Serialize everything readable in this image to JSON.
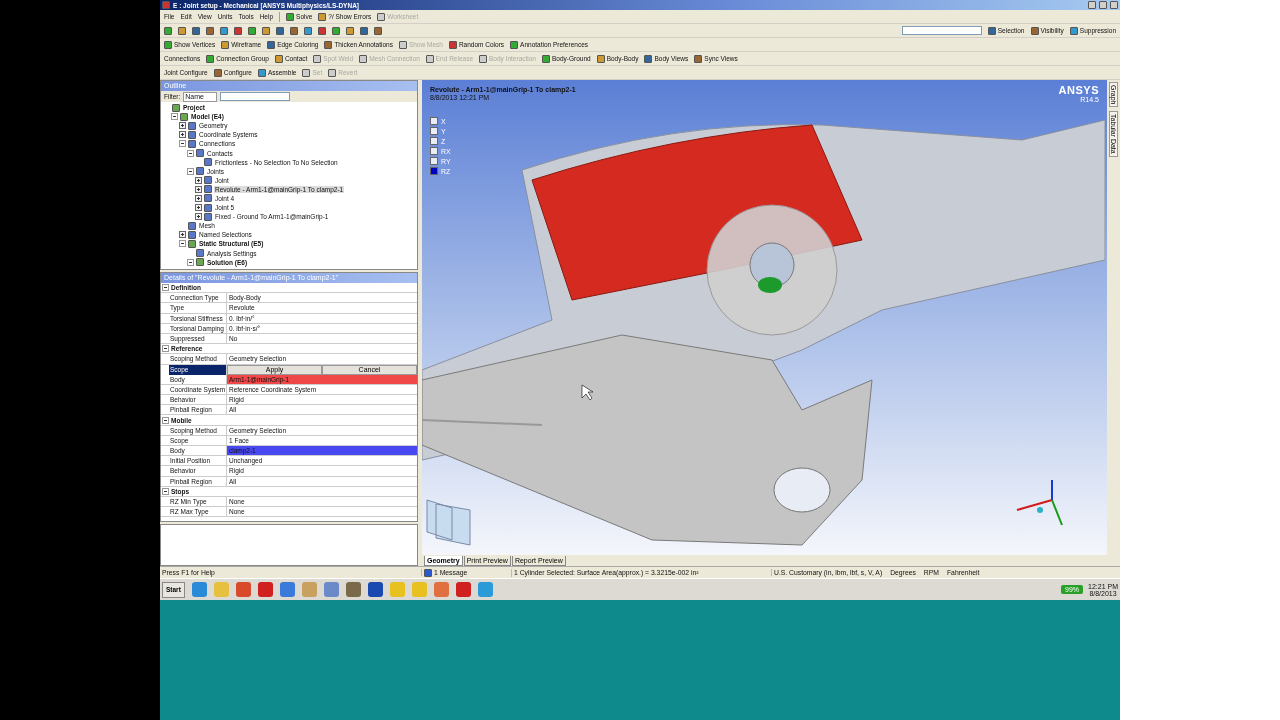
{
  "window": {
    "title": "E : Joint setup - Mechanical [ANSYS Multiphysics/LS-DYNA]"
  },
  "menu": [
    "File",
    "Edit",
    "View",
    "Units",
    "Tools",
    "Help"
  ],
  "toolbar_1": [
    {
      "label": "Solve",
      "disabled": false
    },
    {
      "label": "?/ Show Errors",
      "disabled": false
    },
    {
      "label": "Worksheet",
      "disabled": true
    }
  ],
  "toolbar_2_right": [
    {
      "label": "Selection"
    },
    {
      "label": "Visibility"
    },
    {
      "label": "Suppression"
    }
  ],
  "toolbar_3": [
    {
      "label": "Show Vertices",
      "disabled": false
    },
    {
      "label": "Wireframe",
      "disabled": false
    },
    {
      "label": "Edge Coloring",
      "disabled": false
    },
    {
      "label": "Thicken Annotations",
      "disabled": false
    },
    {
      "label": "Show Mesh",
      "disabled": true
    },
    {
      "label": "Random Colors",
      "disabled": false
    },
    {
      "label": "Annotation Preferences",
      "disabled": false
    }
  ],
  "toolbar_4": {
    "label": "Connections",
    "items": [
      {
        "label": "Connection Group",
        "disabled": false
      },
      {
        "label": "Contact",
        "disabled": false
      },
      {
        "label": "Spot Weld",
        "disabled": true
      },
      {
        "label": "Mesh Connection",
        "disabled": true
      },
      {
        "label": "End Release",
        "disabled": true
      },
      {
        "label": "Body Interaction",
        "disabled": true
      },
      {
        "label": "Body-Ground",
        "disabled": false
      },
      {
        "label": "Body-Body",
        "disabled": false
      },
      {
        "label": "Body Views",
        "disabled": false
      },
      {
        "label": "Sync Views",
        "disabled": false
      }
    ]
  },
  "toolbar_5": {
    "label": "Joint Configure",
    "items": [
      {
        "label": "Configure",
        "disabled": false
      },
      {
        "label": "Assemble",
        "disabled": false
      },
      {
        "label": "Set",
        "disabled": true
      },
      {
        "label": "Revert",
        "disabled": true
      }
    ]
  },
  "outline": {
    "title": "Outline",
    "filter_label": "Filter:",
    "filter_value": "Name",
    "tree": [
      {
        "label": "Project",
        "bold": true,
        "selected": false,
        "children": [
          {
            "label": "Model (E4)",
            "bold": true,
            "selected": false,
            "expanded": true,
            "children": [
              {
                "label": "Geometry",
                "bold": false,
                "selected": false,
                "expanded": false
              },
              {
                "label": "Coordinate Systems",
                "bold": false,
                "selected": false,
                "expanded": false
              },
              {
                "label": "Connections",
                "bold": false,
                "selected": false,
                "expanded": true,
                "children": [
                  {
                    "label": "Contacts",
                    "bold": false,
                    "selected": false,
                    "expanded": true,
                    "children": [
                      {
                        "label": "Frictionless - No Selection To No Selection",
                        "bold": false,
                        "selected": false
                      }
                    ]
                  },
                  {
                    "label": "Joints",
                    "bold": false,
                    "selected": false,
                    "expanded": true,
                    "children": [
                      {
                        "label": "Joint",
                        "bold": false,
                        "selected": false,
                        "expanded": false
                      },
                      {
                        "label": "Revolute - Arm1-1@mainGrip-1 To clamp2-1",
                        "bold": false,
                        "selected": true,
                        "expanded": false
                      },
                      {
                        "label": "Joint 4",
                        "bold": false,
                        "selected": false,
                        "expanded": false
                      },
                      {
                        "label": "Joint 5",
                        "bold": false,
                        "selected": false,
                        "expanded": false
                      },
                      {
                        "label": "Fixed - Ground To Arm1-1@mainGrip-1",
                        "bold": false,
                        "selected": false,
                        "expanded": false
                      }
                    ]
                  }
                ]
              },
              {
                "label": "Mesh",
                "bold": false,
                "selected": false
              },
              {
                "label": "Named Selections",
                "bold": false,
                "selected": false,
                "expanded": false
              },
              {
                "label": "Static Structural (E5)",
                "bold": true,
                "selected": false,
                "expanded": true,
                "children": [
                  {
                    "label": "Analysis Settings",
                    "bold": false,
                    "selected": false
                  },
                  {
                    "label": "Solution (E6)",
                    "bold": true,
                    "selected": false,
                    "expanded": true
                  }
                ]
              }
            ]
          }
        ]
      }
    ]
  },
  "details": {
    "title": "Details of \"Revolute - Arm1-1@mainGrip-1 To clamp2-1\"",
    "groups": [
      {
        "name": "Definition",
        "rows": [
          {
            "kind": "text",
            "label": "Connection Type",
            "value": "Body-Body",
            "selected": false
          },
          {
            "kind": "text",
            "label": "Type",
            "value": "Revolute",
            "selected": false
          },
          {
            "kind": "text",
            "label": "Torsional Stiffness",
            "value": "0. lbf·in/°",
            "selected": false
          },
          {
            "kind": "text",
            "label": "Torsional Damping",
            "value": "0. lbf·in·s/°",
            "selected": false
          },
          {
            "kind": "text",
            "label": "Suppressed",
            "value": "No",
            "selected": false
          }
        ]
      },
      {
        "name": "Reference",
        "rows": [
          {
            "kind": "text",
            "label": "Scoping Method",
            "value": "Geometry Selection",
            "selected": false
          },
          {
            "kind": "actions",
            "label": "Scope",
            "actions": [
              "Apply",
              "Cancel"
            ],
            "selected": true
          },
          {
            "kind": "highlight",
            "label": "Body",
            "value": "Arm1-1@mainGrip-1",
            "color": "#f04848",
            "selected": false
          },
          {
            "kind": "text",
            "label": "Coordinate System",
            "value": "Reference Coordinate System",
            "selected": false
          },
          {
            "kind": "text",
            "label": "Behavior",
            "value": "Rigid",
            "selected": false
          },
          {
            "kind": "text",
            "label": "Pinball Region",
            "value": "All",
            "selected": false
          }
        ]
      },
      {
        "name": "Mobile",
        "rows": [
          {
            "kind": "text",
            "label": "Scoping Method",
            "value": "Geometry Selection",
            "selected": false
          },
          {
            "kind": "text",
            "label": "Scope",
            "value": "1 Face",
            "selected": false
          },
          {
            "kind": "highlight",
            "label": "Body",
            "value": "clamp2-1",
            "color": "#4848f0",
            "selected": false
          },
          {
            "kind": "text",
            "label": "Initial Position",
            "value": "Unchanged",
            "selected": false
          },
          {
            "kind": "text",
            "label": "Behavior",
            "value": "Rigid",
            "selected": false
          },
          {
            "kind": "text",
            "label": "Pinball Region",
            "value": "All",
            "selected": false
          }
        ]
      },
      {
        "name": "Stops",
        "rows": [
          {
            "kind": "text",
            "label": "RZ Min Type",
            "value": "None",
            "selected": false
          },
          {
            "kind": "text",
            "label": "RZ Max Type",
            "value": "None",
            "selected": false
          }
        ]
      }
    ]
  },
  "viewport": {
    "title": "Revolute - Arm1-1@mainGrip-1 To clamp2-1",
    "date": "8/8/2013 12:21 PM",
    "logo": "ANSYS",
    "version": "R14.5",
    "dofs": [
      {
        "label": "X",
        "checked": false
      },
      {
        "label": "Y",
        "checked": false
      },
      {
        "label": "Z",
        "checked": false
      },
      {
        "label": "RX",
        "checked": false
      },
      {
        "label": "RY",
        "checked": false
      },
      {
        "label": "RZ",
        "checked": true
      }
    ],
    "side_tabs": [
      "Graph",
      "Tabular Data"
    ],
    "tabs": [
      {
        "label": "Geometry",
        "selected": true
      },
      {
        "label": "Print Preview",
        "selected": false
      },
      {
        "label": "Report Preview",
        "selected": false
      }
    ]
  },
  "status_bar": {
    "help": "Press F1 for Help",
    "messages": "1 Message",
    "selection": "1 Cylinder Selected: Surface Area(approx.) = 3.3215e-002 in²",
    "units": "U.S. Customary (in, lbm, lbf, s, V, A)",
    "angle": "Degrees",
    "speed": "RPM",
    "temperature": "Fahrenheit"
  },
  "taskbar": {
    "start": "Start",
    "battery": "99%",
    "time": "12:21 PM",
    "date": "8/8/2013"
  }
}
